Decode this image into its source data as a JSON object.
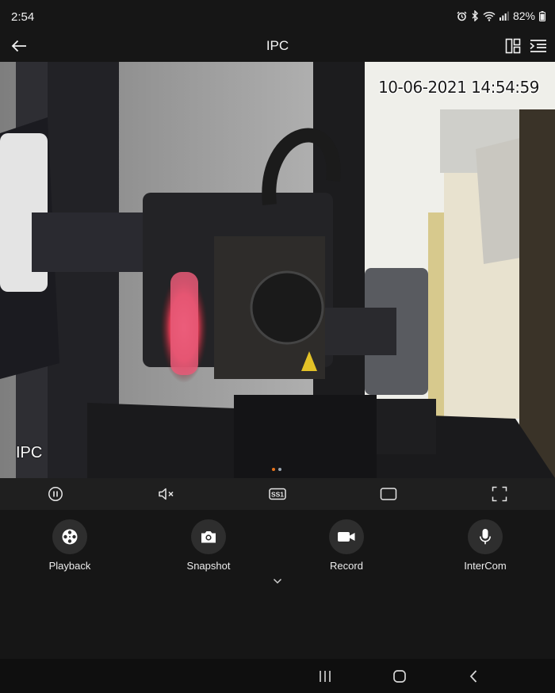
{
  "status_bar": {
    "time": "2:54",
    "battery": "82%",
    "icons": [
      "alarm-icon",
      "bluetooth-icon",
      "wifi-icon",
      "signal-icon",
      "battery-icon"
    ]
  },
  "app_bar": {
    "title": "IPC",
    "left_icon": "back-arrow-icon",
    "right_icons": [
      "layout-icon",
      "menu-icon"
    ]
  },
  "video": {
    "timestamp": "10-06-2021 14:54:59",
    "camera_label": "IPC",
    "page_dots": {
      "count": 2,
      "active_index": 0,
      "active_color": "#e8731c",
      "inactive_color": "#9aa6b2"
    }
  },
  "controls": {
    "items": [
      "pause-icon",
      "mute-icon",
      "quality-icon",
      "screen-ratio-icon",
      "fullscreen-icon"
    ],
    "quality_label": "SS1"
  },
  "actions": {
    "items": [
      {
        "label": "Playback",
        "icon": "playback-reel-icon"
      },
      {
        "label": "Snapshot",
        "icon": "camera-icon"
      },
      {
        "label": "Record",
        "icon": "video-camera-icon"
      },
      {
        "label": "InterCom",
        "icon": "microphone-icon"
      }
    ],
    "more_icon": "chevron-down-icon"
  },
  "nav_bar": {
    "items": [
      "recent-apps-icon",
      "home-icon",
      "nav-back-icon"
    ]
  },
  "colors": {
    "background": "#161616",
    "control_bar": "#1f1f1f",
    "action_circle": "#2e2e2e",
    "text": "#ececec"
  }
}
